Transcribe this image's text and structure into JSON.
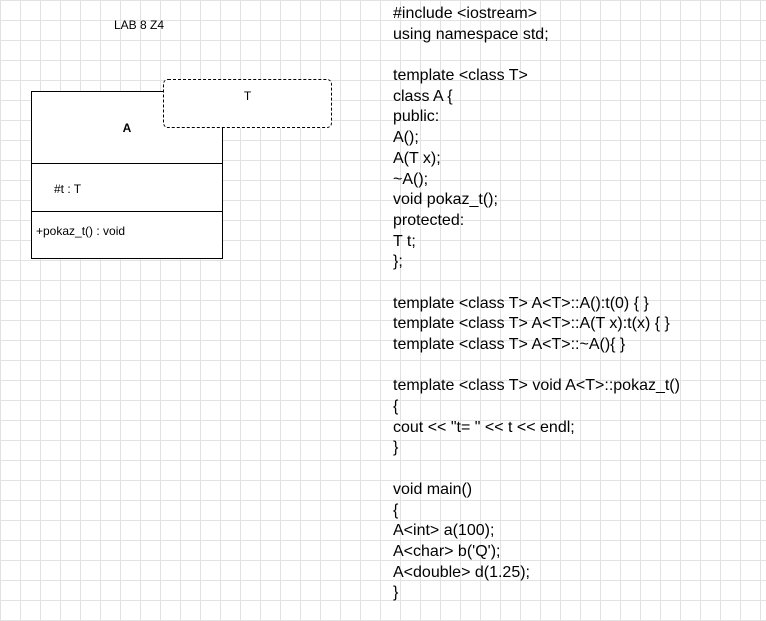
{
  "title": "LAB 8 Z4",
  "uml_class": {
    "name": "A",
    "attribute": "#t : T",
    "operation": "+pokaz_t() : void",
    "template_parameter": "T"
  },
  "code_lines": [
    "#include <iostream>",
    "using namespace std;",
    "",
    "template <class T>",
    "class A {",
    "public:",
    "A();",
    "A(T x);",
    "~A();",
    "void pokaz_t();",
    "protected:",
    "T t;",
    "};",
    "",
    "template <class T> A<T>::A():t(0) { }",
    "template <class T> A<T>::A(T x):t(x) { }",
    "template <class T> A<T>::~A(){ }",
    "",
    "template <class T> void A<T>::pokaz_t()",
    "{",
    "cout << \"t= \" << t << endl;",
    "}",
    "",
    "void main()",
    "{",
    "A<int> a(100);",
    "A<char> b('Q');",
    "A<double> d(1.25);",
    "}"
  ],
  "colors": {
    "background": "#ffffff",
    "grid": "#e2e2e2",
    "stroke": "#000000"
  }
}
